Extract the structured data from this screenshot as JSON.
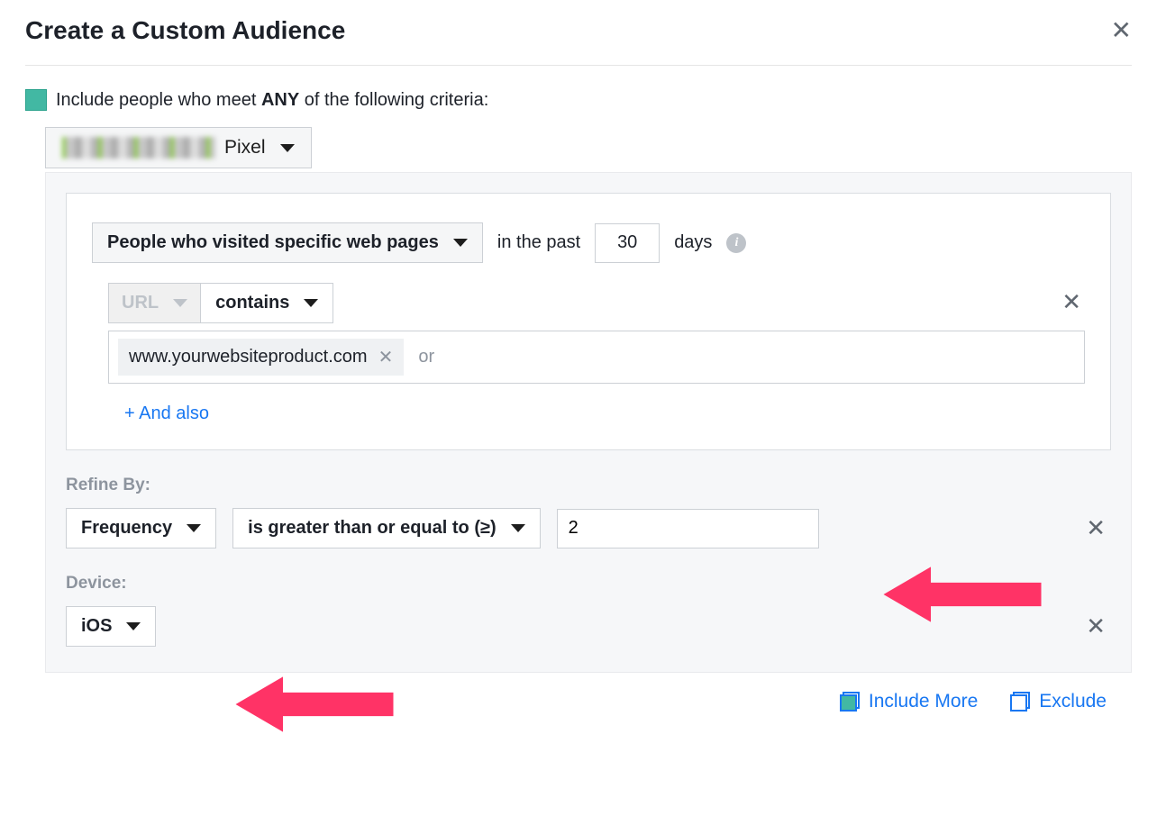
{
  "header": {
    "title": "Create a Custom Audience"
  },
  "criteria": {
    "prefix": "Include people who meet ",
    "emphasis": "ANY",
    "suffix": " of the following criteria:"
  },
  "pixel": {
    "label": "Pixel"
  },
  "visit": {
    "behavior": "People who visited specific web pages",
    "past_prefix": "in the past",
    "days_value": "30",
    "days_suffix": "days"
  },
  "url_filter": {
    "field": "URL",
    "operator": "contains",
    "chip": "www.yourwebsiteproduct.com",
    "or": "or",
    "and_also": "+ And also"
  },
  "refine": {
    "label": "Refine By:",
    "metric": "Frequency",
    "comparison": "is greater than or equal to (≥)",
    "value": "2"
  },
  "device": {
    "label": "Device:",
    "value": "iOS"
  },
  "footer": {
    "include_more": "Include More",
    "exclude": "Exclude"
  },
  "info_glyph": "i"
}
